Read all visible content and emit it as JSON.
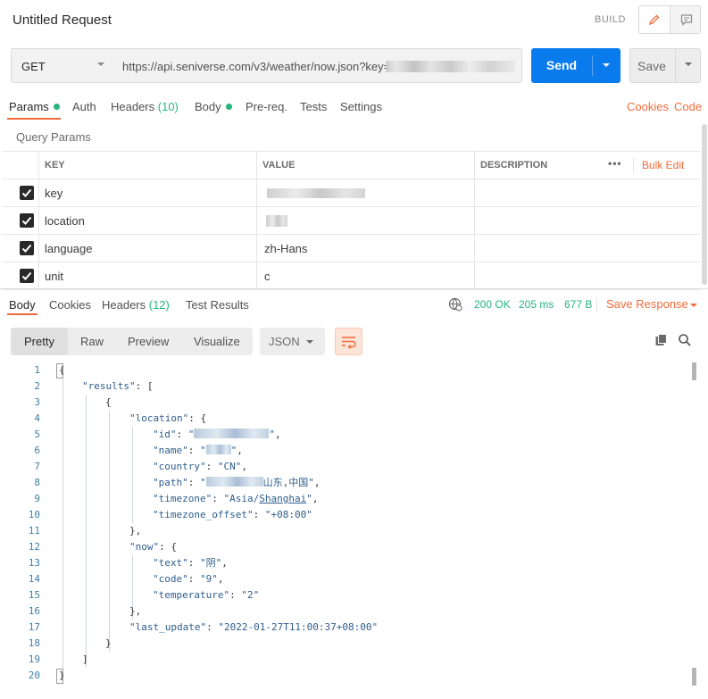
{
  "header": {
    "title": "Untitled Request",
    "build_label": "BUILD"
  },
  "request": {
    "method": "GET",
    "url": "https://api.seniverse.com/v3/weather/now.json?key=",
    "send_label": "Send",
    "save_label": "Save"
  },
  "request_tabs": {
    "params": "Params",
    "auth": "Auth",
    "headers": "Headers",
    "headers_count": "(10)",
    "body": "Body",
    "prereq": "Pre-req.",
    "tests": "Tests",
    "settings": "Settings",
    "cookies": "Cookies",
    "code": "Code"
  },
  "query_params": {
    "title": "Query Params",
    "headers": {
      "key": "KEY",
      "value": "VALUE",
      "description": "DESCRIPTION",
      "more": "•••",
      "bulk_edit": "Bulk Edit"
    },
    "rows": [
      {
        "key": "key",
        "value": ""
      },
      {
        "key": "location",
        "value": ""
      },
      {
        "key": "language",
        "value": "zh-Hans"
      },
      {
        "key": "unit",
        "value": "c"
      }
    ]
  },
  "response_tabs": {
    "body": "Body",
    "cookies": "Cookies",
    "headers": "Headers",
    "headers_count": "(12)",
    "test_results": "Test Results",
    "status": "200 OK",
    "time": "205 ms",
    "size": "677 B",
    "save_response": "Save Response"
  },
  "view_modes": {
    "pretty": "Pretty",
    "raw": "Raw",
    "preview": "Preview",
    "visualize": "Visualize",
    "format": "JSON"
  },
  "code": {
    "line_numbers": [
      "1",
      "2",
      "3",
      "4",
      "5",
      "6",
      "7",
      "8",
      "9",
      "10",
      "11",
      "12",
      "13",
      "14",
      "15",
      "16",
      "17",
      "18",
      "19",
      "20"
    ],
    "results_key": "\"results\"",
    "location_key": "\"location\"",
    "id_key": "\"id\"",
    "name_key": "\"name\"",
    "country_key": "\"country\"",
    "country_val": "\"CN\"",
    "path_key": "\"path\"",
    "path_val_end": "山东,中国\"",
    "timezone_key": "\"timezone\"",
    "timezone_val_a": "\"Asia/",
    "timezone_val_b": "Shanghai",
    "timezone_val_c": "\"",
    "timezone_offset_key": "\"timezone_offset\"",
    "timezone_offset_val": "\"+08:00\"",
    "now_key": "\"now\"",
    "text_key": "\"text\"",
    "text_val": "\"阴\"",
    "code_key": "\"code\"",
    "code_val": "\"9\"",
    "temperature_key": "\"temperature\"",
    "temperature_val": "\"2\"",
    "last_update_key": "\"last_update\"",
    "last_update_val": "\"2022-01-27T11:00:37+08:00\""
  },
  "colors": {
    "accent": "#f26b3a",
    "send": "#097bed",
    "ok": "#26b47f"
  }
}
